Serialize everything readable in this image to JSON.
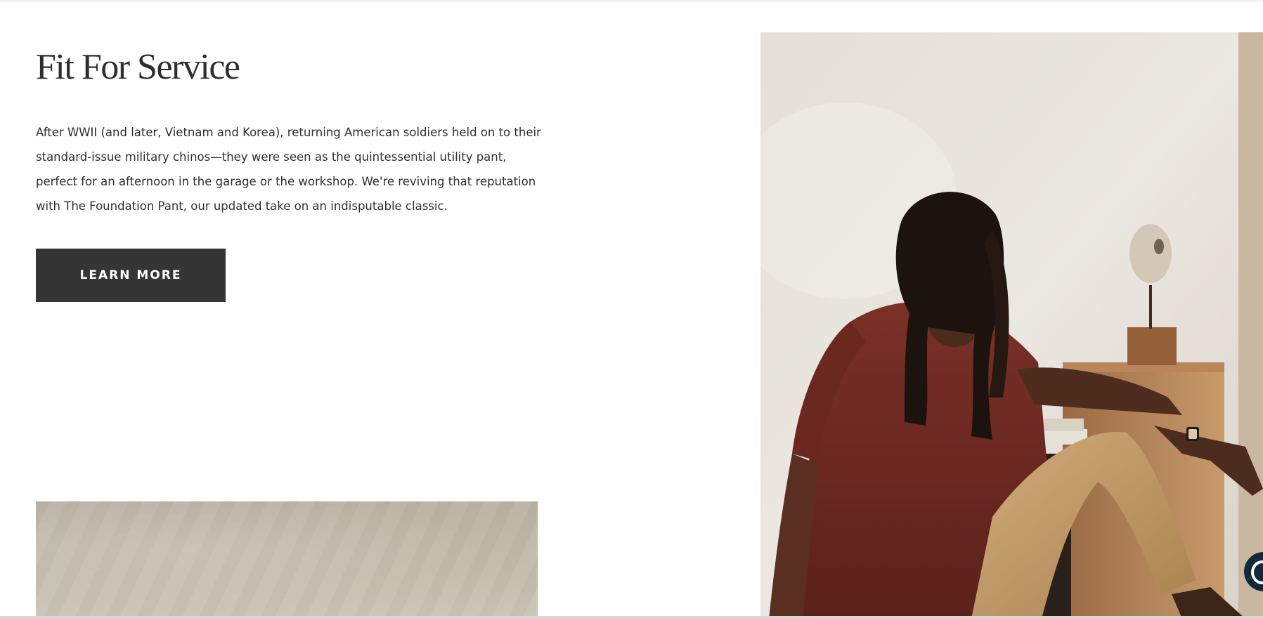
{
  "feature": {
    "title": "Fit For Service",
    "body": "After WWII (and later, Vietnam and Korea), returning American soldiers held on to their standard-issue military chinos—they were seen as the quintessential utility pant, perfect for an afternoon in the garage or the workshop. We're reviving that reputation with The Foundation Pant, our updated take on an indisputable classic.",
    "cta_label": "LEARN MORE"
  },
  "icons": {
    "chat": "chat-bubble-icon"
  },
  "colors": {
    "button": "#353535",
    "heading": "#2e2e2e",
    "shirt": "#6e2a22",
    "chinos": "#c19a6b"
  }
}
